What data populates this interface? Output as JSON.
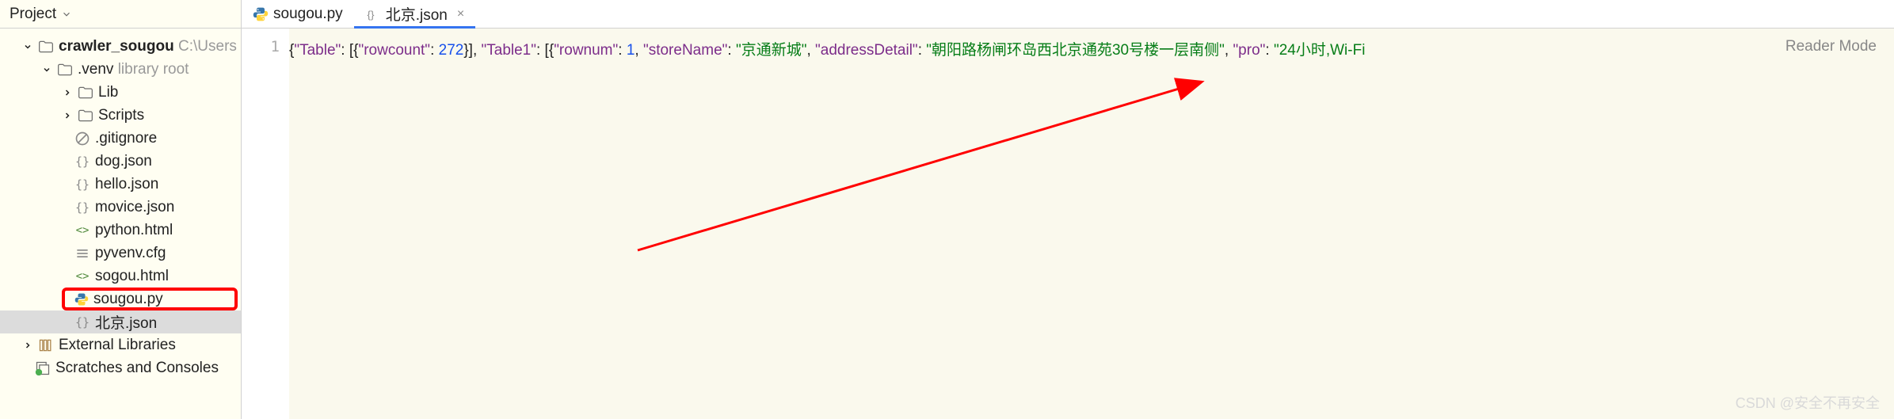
{
  "sidebar_header": {
    "label": "Project"
  },
  "tabs": [
    {
      "label": "sougou.py",
      "type": "py",
      "active": false,
      "closable": false
    },
    {
      "label": "北京.json",
      "type": "json",
      "active": true,
      "closable": true
    }
  ],
  "tree": {
    "root": {
      "name": "crawler_sougou",
      "hint": "C:\\Users"
    },
    "venv": {
      "name": ".venv",
      "hint": "library root"
    },
    "lib": "Lib",
    "scripts": "Scripts",
    "files": [
      {
        "name": ".gitignore",
        "icon": "ignore"
      },
      {
        "name": "dog.json",
        "icon": "json"
      },
      {
        "name": "hello.json",
        "icon": "json"
      },
      {
        "name": "movice.json",
        "icon": "json"
      },
      {
        "name": "python.html",
        "icon": "html"
      },
      {
        "name": "pyvenv.cfg",
        "icon": "cfg"
      },
      {
        "name": "sogou.html",
        "icon": "html"
      },
      {
        "name": "sougou.py",
        "icon": "py"
      },
      {
        "name": "北京.json",
        "icon": "json"
      }
    ],
    "external": "External Libraries",
    "scratches": "Scratches and Consoles"
  },
  "editor": {
    "line_num": "1",
    "segments": [
      {
        "t": "{",
        "c": "punct"
      },
      {
        "t": "\"Table\"",
        "c": "key"
      },
      {
        "t": ": [{",
        "c": "punct"
      },
      {
        "t": "\"rowcount\"",
        "c": "key"
      },
      {
        "t": ": ",
        "c": "punct"
      },
      {
        "t": "272",
        "c": "num"
      },
      {
        "t": "}], ",
        "c": "punct"
      },
      {
        "t": "\"Table1\"",
        "c": "key"
      },
      {
        "t": ": [{",
        "c": "punct"
      },
      {
        "t": "\"rownum\"",
        "c": "key"
      },
      {
        "t": ": ",
        "c": "punct"
      },
      {
        "t": "1",
        "c": "num"
      },
      {
        "t": ", ",
        "c": "punct"
      },
      {
        "t": "\"storeName\"",
        "c": "key"
      },
      {
        "t": ": ",
        "c": "punct"
      },
      {
        "t": "\"京通新城\"",
        "c": "str"
      },
      {
        "t": ", ",
        "c": "punct"
      },
      {
        "t": "\"addressDetail\"",
        "c": "key"
      },
      {
        "t": ": ",
        "c": "punct"
      },
      {
        "t": "\"朝阳路杨闸环岛西北京通苑30号楼一层南侧\"",
        "c": "str"
      },
      {
        "t": ", ",
        "c": "punct"
      },
      {
        "t": "\"pro\"",
        "c": "key"
      },
      {
        "t": ": ",
        "c": "punct"
      },
      {
        "t": "\"24小时,Wi-Fi",
        "c": "str"
      }
    ],
    "reader_mode": "Reader Mode"
  },
  "watermark": "CSDN @安全不再安全"
}
